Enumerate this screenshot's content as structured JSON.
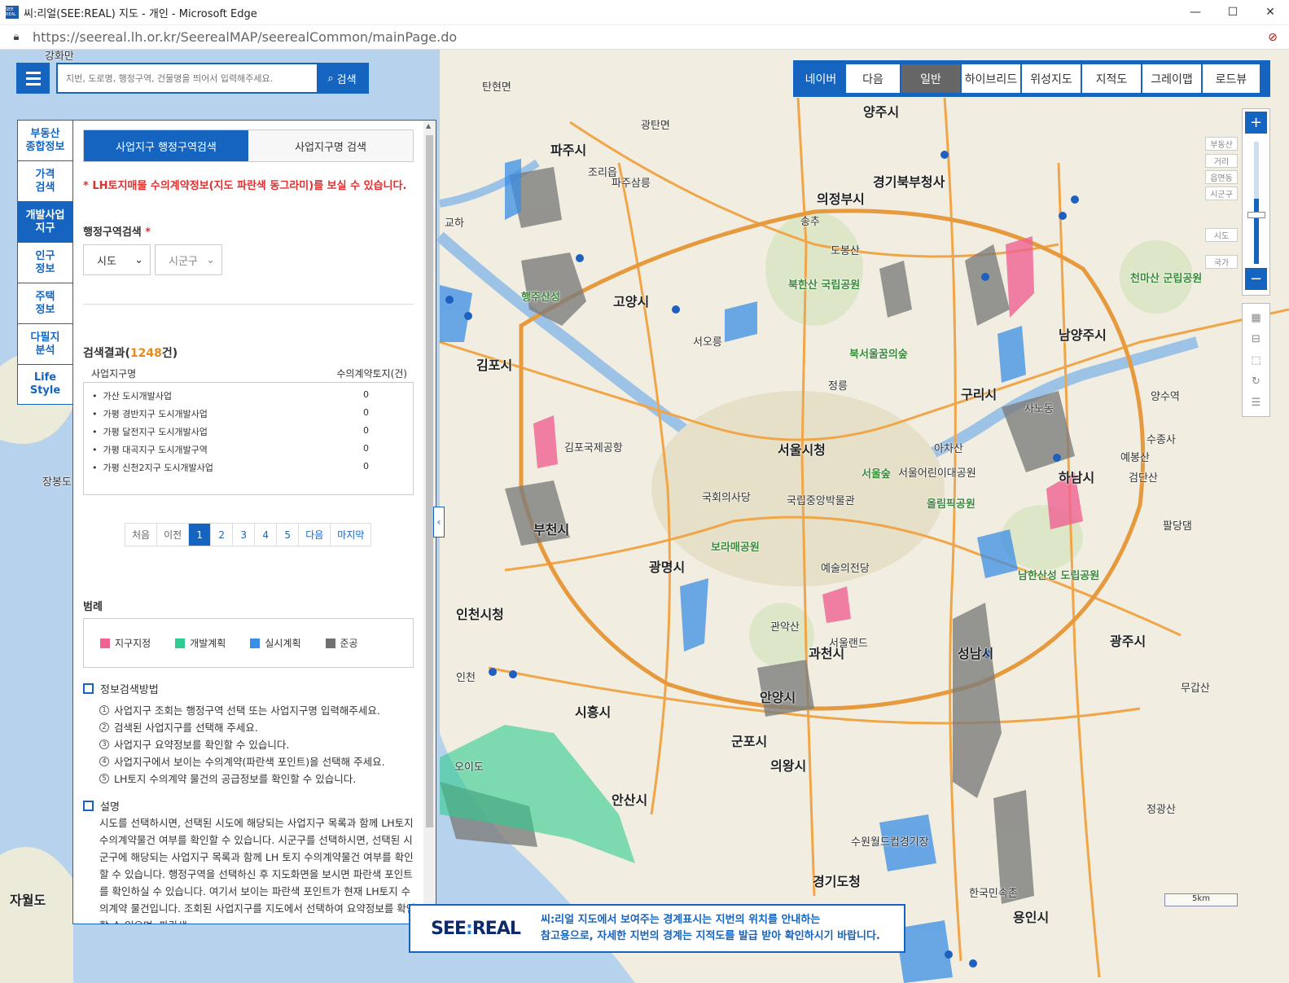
{
  "browser": {
    "title": "씨:리얼(SEE:REAL) 지도 - 개인 - Microsoft Edge",
    "url": "https://seereal.lh.or.kr/SeerealMAP/seerealCommon/mainPage.do",
    "favicon_text": "SEE REAL"
  },
  "search": {
    "placeholder": "지번, 도로명, 행정구역, 건물명을 띄어서 입력해주세요.",
    "button": "검색"
  },
  "map_types": [
    "네이버",
    "다음",
    "일반",
    "하이브리드",
    "위성지도",
    "지적도",
    "그레이맵",
    "로드뷰"
  ],
  "zoom_levels": [
    "부동산",
    "거리",
    "읍면동",
    "시군구",
    "시도",
    "국가"
  ],
  "side_tabs": [
    {
      "label": "부동산\n종합정보",
      "active": false
    },
    {
      "label": "가격\n검색",
      "active": false
    },
    {
      "label": "개발사업\n지구",
      "active": true
    },
    {
      "label": "인구\n정보",
      "active": false
    },
    {
      "label": "주택\n정보",
      "active": false
    },
    {
      "label": "다필지\n분석",
      "active": false
    },
    {
      "label": "Life\nStyle",
      "active": false
    }
  ],
  "panel": {
    "tabs": [
      "사업지구 행정구역검색",
      "사업지구명 검색"
    ],
    "notice": "* LH토지매물 수의계약정보(지도 파란색 동그라미)를 보실 수 있습니다.",
    "region_label": "행정구역검색",
    "req_mark": "*",
    "select_sido": "시도",
    "select_sigungu": "시군구",
    "result_prefix": "검색결과(",
    "result_count": "1248",
    "result_suffix": "건)",
    "col_name": "사업지구명",
    "col_count": "수의계약토지(건)",
    "rows": [
      {
        "name": "가산 도시개발사업",
        "count": "0"
      },
      {
        "name": "가평 경반지구 도시개발사업",
        "count": "0"
      },
      {
        "name": "가평 달전지구 도시개발사업",
        "count": "0"
      },
      {
        "name": "가평 대곡지구 도시개발구역",
        "count": "0"
      },
      {
        "name": "가평 신천2지구 도시개발사업",
        "count": "0"
      }
    ],
    "pager": [
      "처음",
      "이전",
      "1",
      "2",
      "3",
      "4",
      "5",
      "다음",
      "마지막"
    ],
    "legend_title": "범례",
    "legend": [
      {
        "label": "지구지정",
        "color": "#f06292"
      },
      {
        "label": "개발계획",
        "color": "#2ecc8f"
      },
      {
        "label": "실시계획",
        "color": "#3a8ee6"
      },
      {
        "label": "준공",
        "color": "#707070"
      }
    ],
    "info_title": "정보검색방법",
    "steps": [
      "사업지구 조회는 행정구역 선택 또는 사업지구명 입력해주세요.",
      "검색된 사업지구를 선택해 주세요.",
      "사업지구 요약정보를 확인할 수 있습니다.",
      "사업지구에서 보이는 수의계약(파란색 포인트)을 선택해 주세요.",
      "LH토지 수의계약 물건의 공급정보를 확인할 수 있습니다."
    ],
    "desc_title": "설명",
    "desc": "시도를 선택하시면, 선택된 시도에 해당되는 사업지구 목록과 함께 LH토지 수의계약물건 여부를 확인할 수 있습니다. 시군구를 선택하시면, 선택된 시군구에 해당되는 사업지구 목록과 함께 LH 토지 수의계약물건 여부를 확인할 수 있습니다. 행정구역을 선택하신 후 지도화면을 보시면 파란색 포인트를 확인하실 수 있습니다. 여기서 보이는 파란색 포인트가 현재 LH토지 수의계약 물건입니다. 조회된 사업지구를 지도에서 선택하여 요약정보를 확인할 수 있으며, 파란색"
  },
  "banner": {
    "logo_a": "SEE",
    "logo_colon": ":",
    "logo_b": "REAL",
    "line1": "씨:리얼 지도에서 보여주는 경계표시는 지번의 위치를 안내하는",
    "line2": "참고용으로, 자세한 지번의 경계는 지적도를 발급 받아 확인하시기 바랍니다."
  },
  "scale": "5km",
  "map_labels": [
    "강화만",
    "탄현면",
    "양주시",
    "파주시",
    "경기북부청사",
    "의정부시",
    "고양시",
    "북한산 국립공원",
    "김포시",
    "서울시청",
    "구리시",
    "남양주시",
    "천마산 군립공원",
    "하남시",
    "부천시",
    "광명시",
    "인천시청",
    "과천시",
    "성남시",
    "남한산성 도립공원",
    "광주시",
    "안양시",
    "군포시",
    "의왕시",
    "시흥시",
    "안산시",
    "오이도",
    "경기도청",
    "용인시",
    "자월도",
    "장봉도",
    "예봉산",
    "수종사",
    "올림픽공원",
    "국회의사당",
    "김포국제공항",
    "서울어린이대공원",
    "국립중앙박물관",
    "보라매공원",
    "도봉산",
    "서오릉",
    "서울숲",
    "예술의전당",
    "관악산",
    "서울랜드",
    "무갑산",
    "정광산",
    "아차산",
    "한국민속촌",
    "수원월드컵경기장",
    "행주산성",
    "북서울꿈의숲",
    "정릉",
    "송추",
    "광탄면",
    "조리읍",
    "파주삼릉",
    "교하",
    "인천",
    "사노동",
    "양수역",
    "팔당댐",
    "검단산"
  ]
}
